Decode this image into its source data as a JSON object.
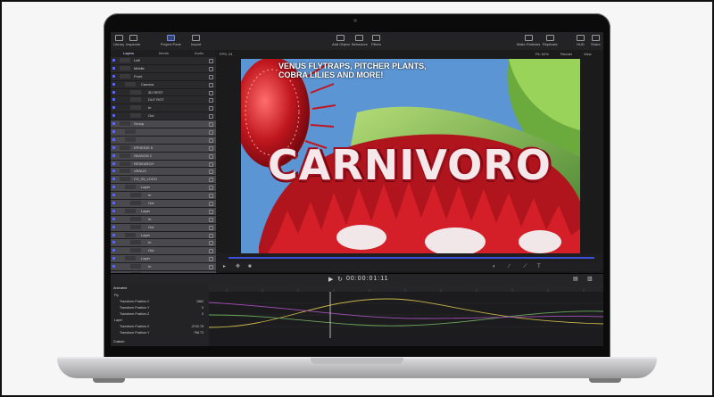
{
  "toolbar": {
    "left": [
      "Library",
      "Inspector",
      "Project Pane",
      "Import"
    ],
    "center": [
      "Add Object",
      "Behaviors",
      "Filters"
    ],
    "right": [
      "Make Particles",
      "Replicate",
      "HUD",
      "Share"
    ]
  },
  "panel_tabs": [
    "Layers",
    "Media",
    "Audio"
  ],
  "viewer": {
    "fps": "FPS: 24",
    "zoom": "Fit: 62%",
    "render": "Render",
    "view": "View"
  },
  "layers": [
    {
      "name": "Left",
      "sel": false,
      "indent": 0
    },
    {
      "name": "Middle",
      "sel": false,
      "indent": 0
    },
    {
      "name": "Front",
      "sel": false,
      "indent": 0
    },
    {
      "name": "Camera",
      "sel": false,
      "indent": 1
    },
    {
      "name": "3D REST",
      "sel": false,
      "indent": 2
    },
    {
      "name": "DUT ROT",
      "sel": false,
      "indent": 2
    },
    {
      "name": "In",
      "sel": false,
      "indent": 2
    },
    {
      "name": "Out",
      "sel": false,
      "indent": 2
    },
    {
      "name": "Group",
      "sel": true,
      "indent": 0
    },
    {
      "name": "",
      "sel": true,
      "indent": 1
    },
    {
      "name": "",
      "sel": true,
      "indent": 1
    },
    {
      "name": "EPISODE 6",
      "sel": true,
      "indent": 0
    },
    {
      "name": "SEASON 2",
      "sel": true,
      "indent": 0
    },
    {
      "name": "",
      "sel": true,
      "indent": 0
    },
    {
      "name": "VENUS",
      "sel": true,
      "indent": 0
    },
    {
      "name": "CV_03_LOGO",
      "sel": true,
      "indent": 0
    },
    {
      "name": "Layer",
      "sel": true,
      "indent": 1
    },
    {
      "name": "In",
      "sel": true,
      "indent": 2
    },
    {
      "name": "Out",
      "sel": true,
      "indent": 2
    },
    {
      "name": "Layer",
      "sel": true,
      "indent": 1
    },
    {
      "name": "In",
      "sel": true,
      "indent": 2
    },
    {
      "name": "Out",
      "sel": true,
      "indent": 2
    },
    {
      "name": "Layer",
      "sel": true,
      "indent": 1
    },
    {
      "name": "In",
      "sel": true,
      "indent": 2
    },
    {
      "name": "Out",
      "sel": true,
      "indent": 2
    },
    {
      "name": "Layer",
      "sel": true,
      "indent": 1
    },
    {
      "name": "In",
      "sel": true,
      "indent": 2
    },
    {
      "name": "Out",
      "sel": true,
      "indent": 2
    },
    {
      "name": "Group",
      "sel": false,
      "indent": 0
    },
    {
      "name": "CV_03_SN",
      "sel": false,
      "indent": 1
    },
    {
      "name": "Color Wheels",
      "sel": false,
      "indent": 2
    }
  ],
  "layer_extra": {
    "episode": "EPISODE 6",
    "season": "SEASON 2",
    "research": "RESEARCH"
  },
  "artwork": {
    "headline": "VENUS FLYTRAPS, PITCHER PLANTS, COBRA LILIES AND MORE!",
    "wordmark": "CARNIVORO"
  },
  "transport": {
    "timecode": "00:00:01:11"
  },
  "keyframes": {
    "filter": "Animated",
    "custom": "Custom",
    "rows": [
      {
        "label": "Fly",
        "indent": 0
      },
      {
        "label": "Transform.Position.X",
        "value": "1862",
        "indent": 1
      },
      {
        "label": "Transform.Position.Y",
        "value": "0",
        "indent": 1
      },
      {
        "label": "Transform.Position.Z",
        "value": "0",
        "indent": 1
      },
      {
        "label": "Layer",
        "indent": 0
      },
      {
        "label": "Transform.Position.X",
        "value": "-3742.78",
        "indent": 1
      },
      {
        "label": "Transform.Position.Y",
        "value": "798.73",
        "indent": 1
      }
    ]
  },
  "colors": {
    "accent": "#5a6cff",
    "curve1": "#c9b44a",
    "curve2": "#6aa65a",
    "curve3": "#a34fb5"
  }
}
